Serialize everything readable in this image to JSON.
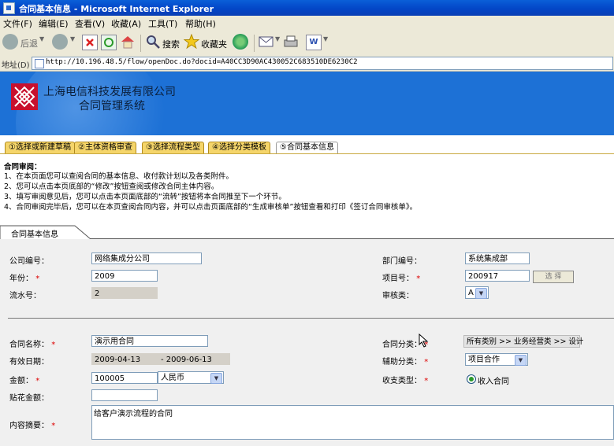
{
  "window": {
    "title": "合同基本信息 - Microsoft Internet Explorer"
  },
  "menu": {
    "items": [
      "文件(F)",
      "编辑(E)",
      "查看(V)",
      "收藏(A)",
      "工具(T)",
      "帮助(H)"
    ]
  },
  "toolbar": {
    "back_label": "后退",
    "search_label": "搜索",
    "favorites_label": "收藏夹"
  },
  "address": {
    "label": "地址(D)",
    "url": "http://10.196.48.5/flow/openDoc.do?docid=A40CC3D90AC430052C683510DE6230C2"
  },
  "banner": {
    "company": "上海电信科技发展有限公司",
    "system": "合同管理系统",
    "brand_color": "#1d71d6"
  },
  "steps": [
    {
      "label": "①选择或新建草稿"
    },
    {
      "label": "②主体资格审查"
    },
    {
      "label": "③选择流程类型"
    },
    {
      "label": "④选择分类模板"
    },
    {
      "label": "⑤合同基本信息"
    }
  ],
  "instructions": {
    "title": "合同审阅：",
    "lines": [
      "1、在本页面您可以查阅合同的基本信息、收付款计划以及各类附件。",
      "2、您可以点击本页底部的“修改”按钮查阅或修改合同主体内容。",
      "3、填写审阅意见后，您可以点击本页面底部的“流转”按钮将本合同推至下一个环节。",
      "4、合同审阅完毕后，您可以在本页查阅合同内容，并可以点击页面底部的“生成审核单”按钮查看和打印《签订合同审核单》。"
    ]
  },
  "form": {
    "tab_label": "合同基本信息",
    "company_code": {
      "label": "公司编号：",
      "value": "网络集成分公司"
    },
    "year": {
      "label": "年份：",
      "value": "2009"
    },
    "serial": {
      "label": "流水号：",
      "value": "2"
    },
    "dept_code": {
      "label": "部门编号：",
      "value": "系统集成部"
    },
    "project_no": {
      "label": "项目号：",
      "value": "200917",
      "button": "选 择"
    },
    "audit_type": {
      "label": "审核类：",
      "value": "A"
    },
    "contract_name": {
      "label": "合同名称：",
      "value": "演示用合同"
    },
    "valid_date": {
      "label": "有效日期：",
      "start": "2009-04-13",
      "end": "- 2009-06-13"
    },
    "amount": {
      "label": "金额：",
      "value": "100005",
      "currency": "人民币"
    },
    "stamp_amount": {
      "label": "贴花金额：",
      "value": ""
    },
    "summary": {
      "label": "内容摘要：",
      "value": "给客户演示流程的合同"
    },
    "contract_category": {
      "label": "合同分类：",
      "value": "所有类别 >> 业务经营类 >> 设计"
    },
    "aux_category": {
      "label": "辅助分类：",
      "value": "项目合作"
    },
    "payment_type": {
      "label": "收支类型：",
      "value": "收入合同"
    },
    "required_mark": "*"
  }
}
